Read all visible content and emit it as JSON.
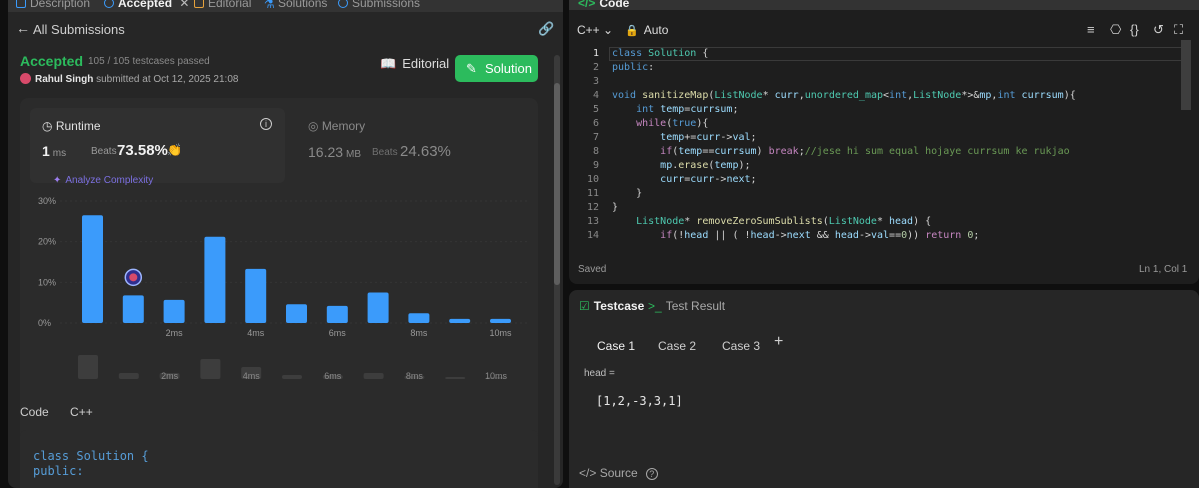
{
  "left_tabs": [
    {
      "label": "Description"
    },
    {
      "label": "Accepted"
    },
    {
      "label": "Editorial"
    },
    {
      "label": "Solutions"
    },
    {
      "label": "Submissions"
    }
  ],
  "back": {
    "label": "All Submissions"
  },
  "submission": {
    "status": "Accepted",
    "tests": "105 / 105 testcases passed",
    "author": "Rahul Singh",
    "submitted_text": "submitted at Oct 12, 2025 21:08",
    "editorial_label": "Editorial",
    "solution_label": "Solution"
  },
  "runtime": {
    "title": "Runtime",
    "value": "1",
    "unit": "ms",
    "beats_label": "Beats",
    "beats": "73.58%",
    "info": "i"
  },
  "analyze": {
    "label": "Analyze Complexity"
  },
  "memory": {
    "title": "Memory",
    "value": "16.23",
    "unit": "MB",
    "beats_label": "Beats",
    "beats": "24.63%"
  },
  "chart_data": {
    "type": "bar",
    "title": "",
    "xlabel": "",
    "ylabel": "",
    "y_ticks": [
      "30%",
      "20%",
      "10%",
      "0%"
    ],
    "ylim": [
      0,
      30
    ],
    "x_ticks": [
      "2ms",
      "4ms",
      "6ms",
      "8ms",
      "10ms"
    ],
    "values": [
      26.5,
      6.8,
      5.7,
      21.2,
      13.3,
      4.6,
      4.2,
      7.5,
      2.4,
      1.0,
      1.0
    ],
    "highlight_index": 1,
    "bar_color": "#3b9bfb",
    "minimap_values": [
      6,
      1.5,
      1.5,
      5,
      3,
      1,
      1,
      1.5,
      0.8,
      0.5,
      0.5
    ],
    "minimap_color": "#3d3d3d"
  },
  "code_section": {
    "label": "Code",
    "lang": "C++"
  },
  "snippet": [
    "class Solution {",
    "public:"
  ],
  "code_panel": {
    "tab": "Code",
    "lang": "C++",
    "mode": "Auto",
    "saved": "Saved",
    "cursor": "Ln 1, Col 1",
    "line_numbers": [
      "1",
      "2",
      "3",
      "4",
      "5",
      "6",
      "7",
      "8",
      "9",
      "10",
      "11",
      "12",
      "13",
      "14"
    ]
  },
  "code_lines": [
    "class Solution {",
    "public:",
    "",
    "void sanitizeMap(ListNode* curr,unordered_map<int,ListNode*>&mp,int currsum){",
    "    int temp=currsum;",
    "    while(true){",
    "        temp+=curr->val;",
    "        if(temp==currsum) break;//jese hi sum equal hojaye currsum ke rukjao",
    "        mp.erase(temp);",
    "        curr=curr->next;",
    "    }",
    "}",
    "    ListNode* removeZeroSumSublists(ListNode* head) {",
    "        if(!head || ( !head->next && head->val==0)) return 0;"
  ],
  "testcase": {
    "tab": "Testcase",
    "result_tab": "Test Result",
    "cases": [
      "Case 1",
      "Case 2",
      "Case 3"
    ],
    "add": "+",
    "param_label": "head =",
    "param_value": "[1,2,-3,3,1]",
    "source": "Source"
  }
}
